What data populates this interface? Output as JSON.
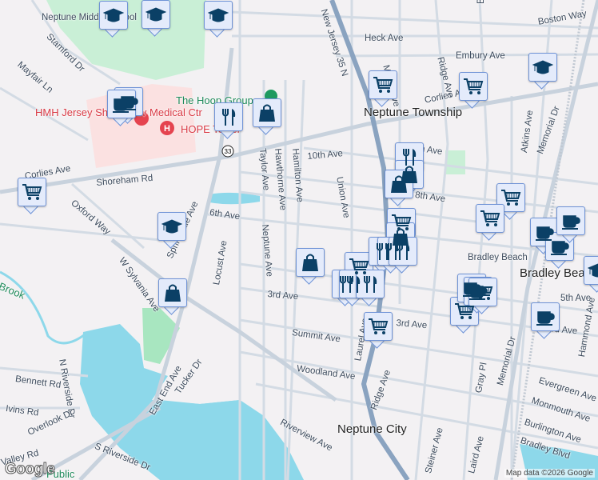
{
  "map": {
    "colors": {
      "land": "#f3f1f3",
      "road": "#d3dbe4",
      "highway": "#8aa3c0",
      "water": "#8dd8ea",
      "park": "#a8e6c0",
      "hospital": "#fbe1e1",
      "marker_fill": "#e4ebfb",
      "marker_border": "#6f93d6",
      "marker_icon": "#0b4066"
    },
    "places": {
      "neptune_township": "Neptune Township",
      "neptune_city": "Neptune City",
      "bradley_beach": "Bradley Beach",
      "bradley_beach_station": "Bradley Beach",
      "hospital": "HMH Jersey Shore Univ Medical Ctr",
      "hope_tower": "HOPE Tower",
      "hoop_group": "The Hoop Group",
      "neptune_middle_school": "Neptune Middle School",
      "brook": "Brook",
      "public": "Public"
    },
    "streets": [
      "Heck Ave",
      "Boston Way",
      "Embury Ave",
      "Borden Ave",
      "Stamford Dr",
      "Mayfair Ln",
      "Corlies Ave",
      "Corlies Ave",
      "Shoreham Rd",
      "Oxford Way",
      "6th Ave",
      "10th Ave",
      "10th Ave",
      "8th Ave",
      "Union Ave",
      "Hamilton Ave",
      "Hawthorne Ave",
      "Taylor Ave",
      "Neptune Ave",
      "Myrtle Ave",
      "Ridge Ave",
      "Atkins Ave",
      "Memorial Dr",
      "Memorial Dr",
      "W Sylvania Ave",
      "Springdale Ave",
      "Locust Ave",
      "3rd Ave",
      "3rd Ave",
      "Summit Ave",
      "Woodland Ave",
      "Laurel Ave",
      "Ridge Ave",
      "Gray Pl",
      "Evergreen Ave",
      "Monmouth Ave",
      "Burlington Ave",
      "Bradley Blvd",
      "Steiner Ave",
      "Laird Ave",
      "Riverview Ave",
      "East End Ave",
      "Tucker Dr",
      "Bennett Rd",
      "N Riverside Dr",
      "Ivins Rd",
      "Overlook Dr",
      "S Riverside Dr",
      "Valley Rd",
      "5th Ave",
      "Hammond Ave",
      "New Jersey 35 N",
      "3rd Ave"
    ],
    "route_shield": "33",
    "markers": [
      "school",
      "school",
      "school",
      "school",
      "school",
      "cafe",
      "cafe",
      "restaurant",
      "shopping",
      "cart",
      "cart",
      "cart",
      "restaurant",
      "shopping",
      "shopping",
      "cart",
      "cart",
      "cart",
      "shopping",
      "cart",
      "restaurant",
      "restaurant",
      "restaurant",
      "restaurant",
      "restaurant",
      "restaurant",
      "shopping",
      "shopping",
      "cart",
      "cafe",
      "cafe",
      "cafe",
      "cafe",
      "cafe",
      "cart",
      "cafe",
      "cart",
      "school"
    ],
    "attribution": "Map data ©2026 Google",
    "logo": "Google"
  }
}
